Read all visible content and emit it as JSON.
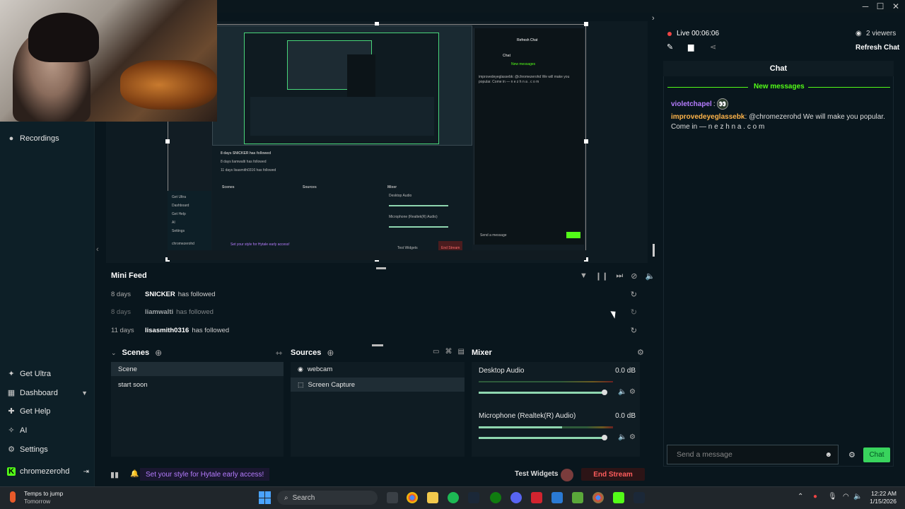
{
  "sidebar": {
    "items_top": [
      {
        "label": "Recordings",
        "icon": "play-circle-icon"
      }
    ],
    "items_bottom": [
      {
        "label": "Get Ultra",
        "icon": "ultra-icon"
      },
      {
        "label": "Dashboard",
        "icon": "dashboard-icon"
      },
      {
        "label": "Get Help",
        "icon": "help-icon"
      },
      {
        "label": "AI",
        "icon": "ai-icon"
      },
      {
        "label": "Settings",
        "icon": "gear-icon"
      },
      {
        "label": "chromezerohd",
        "icon": "kick-icon"
      }
    ]
  },
  "live": {
    "status_label": "Live 00:06:06",
    "viewers": "2 viewers",
    "refresh_chat": "Refresh Chat"
  },
  "mini_feed": {
    "title": "Mini Feed",
    "rows": [
      {
        "days": "8 days",
        "user": "SNICKER",
        "action": "has followed"
      },
      {
        "days": "8 days",
        "user": "liamwalti",
        "action": "has followed"
      },
      {
        "days": "11 days",
        "user": "lisasmith0316",
        "action": "has followed"
      }
    ]
  },
  "scenes": {
    "title": "Scenes",
    "items": [
      "Scene",
      "start soon"
    ]
  },
  "sources": {
    "title": "Sources",
    "items": [
      "webcam",
      "Screen Capture"
    ]
  },
  "mixer": {
    "title": "Mixer",
    "channels": [
      {
        "name": "Desktop Audio",
        "level": "0.0 dB",
        "volume": 0.97
      },
      {
        "name": "Microphone (Realtek(R) Audio)",
        "level": "0.0 dB",
        "volume": 0.97
      }
    ]
  },
  "status_bar": {
    "promo": "Set your style for Hytale early access!",
    "test_widgets": "Test Widgets",
    "end_stream": "End Stream"
  },
  "chat": {
    "header": "Chat",
    "new_messages": "New messages",
    "messages": [
      {
        "user": "violetchapel",
        "text": ""
      },
      {
        "user": "improvedeyeglassebk",
        "text": "@chromezerohd We will make you popular. Come in — n e z h n a . c o m"
      }
    ],
    "input_placeholder": "Send a message",
    "send_label": "Chat"
  },
  "nested": {
    "chat_header": "Chat",
    "new_messages": "New messages",
    "message": "improvedeyeglassebk: @chromezerohd We will make you popular. Come in — n e z h n a . c o m",
    "refresh": "Refresh Chat",
    "feed_rows": [
      "8 days SNICKER has followed",
      "8 days liamwalti has followed",
      "11 days lisasmith0316 has followed"
    ],
    "scenes": "Scenes",
    "sources": "Sources",
    "mixer": "Mixer",
    "desktop_audio": "Desktop Audio",
    "microphone": "Microphone (Realtek(R) Audio)",
    "send": "Send a message",
    "test_widgets": "Test Widgets",
    "end_stream": "End Stream",
    "promo": "Set your style for Hytale early access!",
    "sidebar": [
      "Get Ultra",
      "Dashboard",
      "Get Help",
      "AI",
      "Settings",
      "chromezerohd"
    ]
  },
  "taskbar": {
    "weather_line1": "Temps to jump",
    "weather_line2": "Tomorrow",
    "search": "Search",
    "time": "12:22 AM",
    "date": "1/15/2026"
  },
  "colors": {
    "accent_green": "#53fc18",
    "live_red": "#e44",
    "violet_user": "#b67cff",
    "orange_user": "#ffb44a"
  }
}
